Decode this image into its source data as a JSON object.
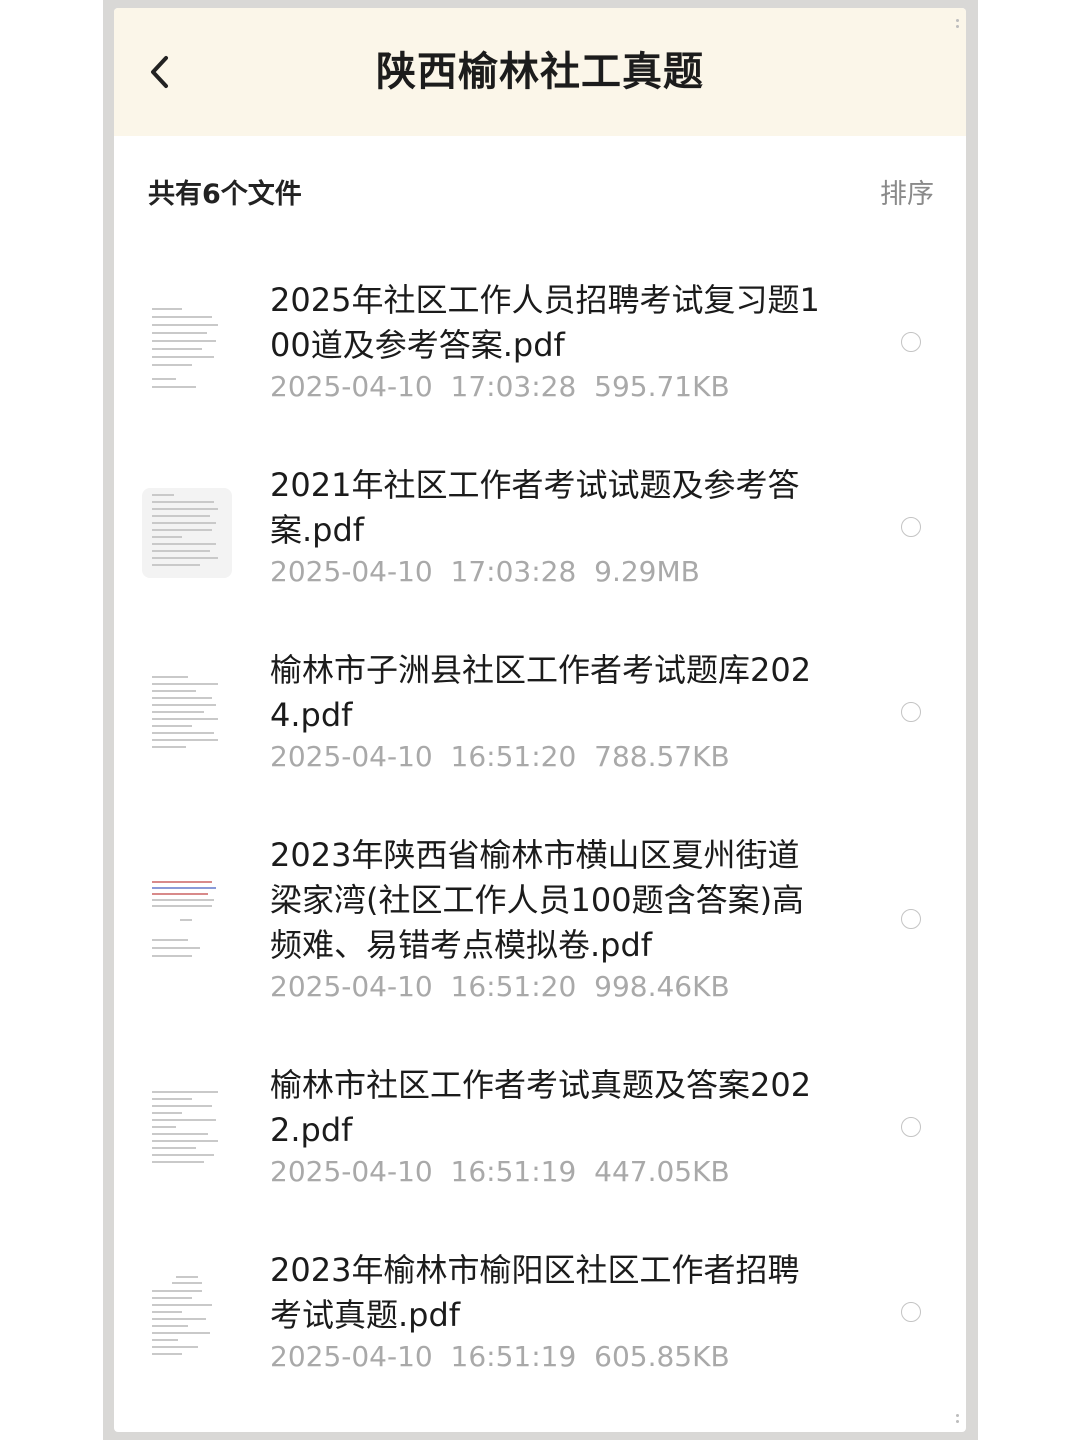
{
  "header": {
    "title": "陕西榆林社工真题"
  },
  "toolbar": {
    "summary": "共有6个文件",
    "sort_label": "排序"
  },
  "files": [
    {
      "name": "2025年社区工作人员招聘考试复习题100道及参考答案.pdf",
      "date": "2025-04-10",
      "time": "17:03:28",
      "size": "595.71KB"
    },
    {
      "name": "2021年社区工作者考试试题及参考答案.pdf",
      "date": "2025-04-10",
      "time": "17:03:28",
      "size": "9.29MB"
    },
    {
      "name": "榆林市子洲县社区工作者考试题库2024.pdf",
      "date": "2025-04-10",
      "time": "16:51:20",
      "size": "788.57KB"
    },
    {
      "name": "2023年陕西省榆林市横山区夏州街道梁家湾(社区工作人员100题含答案)高频难、易错考点模拟卷.pdf",
      "date": "2025-04-10",
      "time": "16:51:20",
      "size": "998.46KB"
    },
    {
      "name": "榆林市社区工作者考试真题及答案2022.pdf",
      "date": "2025-04-10",
      "time": "16:51:19",
      "size": "447.05KB"
    },
    {
      "name": "2023年榆林市榆阳区社区工作者招聘考试真题.pdf",
      "date": "2025-04-10",
      "time": "16:51:19",
      "size": "605.85KB"
    }
  ]
}
